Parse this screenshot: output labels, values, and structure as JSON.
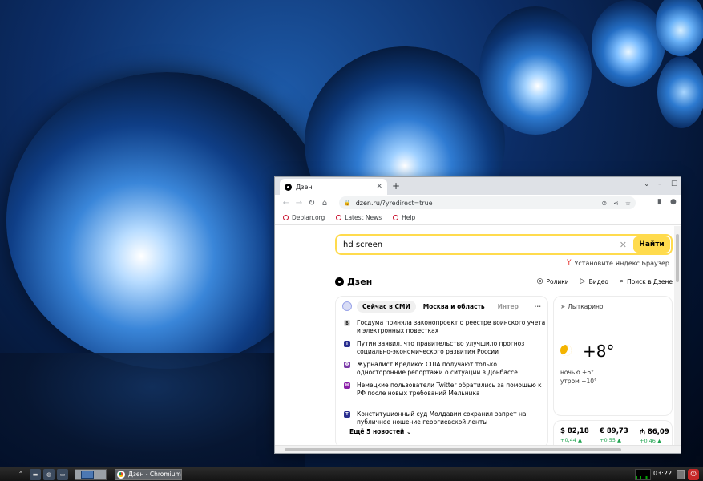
{
  "browser": {
    "tab_title": "Дзен",
    "new_tab_symbol": "+",
    "url_host": "dzen.ru",
    "url_path": "/?yredirect=true",
    "bookmarks": [
      "Debian.org",
      "Latest News",
      "Help"
    ]
  },
  "page": {
    "search_query": "hd screen",
    "search_button": "Найти",
    "promo_text": "Установите Яндекс Браузер",
    "brand": "Дзен",
    "nav": [
      "Ролики",
      "Видео",
      "Поиск в Дзене"
    ],
    "news_tabs": [
      "Сейчас в СМИ",
      "Москва и область",
      "Интер"
    ],
    "news": [
      {
        "text": "Госдума приняла законопроект о реестре воинского учета и электронных повестках",
        "src_color": "#ffffff",
        "src_label": "В"
      },
      {
        "text": "Путин заявил, что правительство улучшило прогноз социально-экономического развития России",
        "src_color": "#2a2f8f",
        "src_label": "Т"
      },
      {
        "text": "Журналист Кредико: США получают только односторонние репортажи о ситуации в Донбассе",
        "src_color": "#7b3aa8",
        "src_label": "Ф"
      },
      {
        "text": "Немецкие пользователи Twitter обратились за помощью к РФ после новых требований Мельника",
        "src_color": "#8b1fa8",
        "src_label": "Н"
      },
      {
        "text": "Конституционный суд Молдавии сохранил запрет на публичное ношение георгиевской ленты",
        "src_color": "#2a2f8f",
        "src_label": "Т"
      }
    ],
    "more_news": "Ещё 5 новостей",
    "weather": {
      "city": "Лыткарино",
      "temp": "+8°",
      "night": "ночью +6°",
      "morning": "утром +10°"
    },
    "rates": [
      {
        "value": "$ 82,18",
        "delta": "+0,44 ▲"
      },
      {
        "value": "€ 89,73",
        "delta": "+0,55 ▲"
      },
      {
        "value": "₼ 86,09",
        "delta": "+0,46 ▲"
      }
    ]
  },
  "taskbar": {
    "task_label": "Дзен - Chromium",
    "clock": "03:22"
  }
}
